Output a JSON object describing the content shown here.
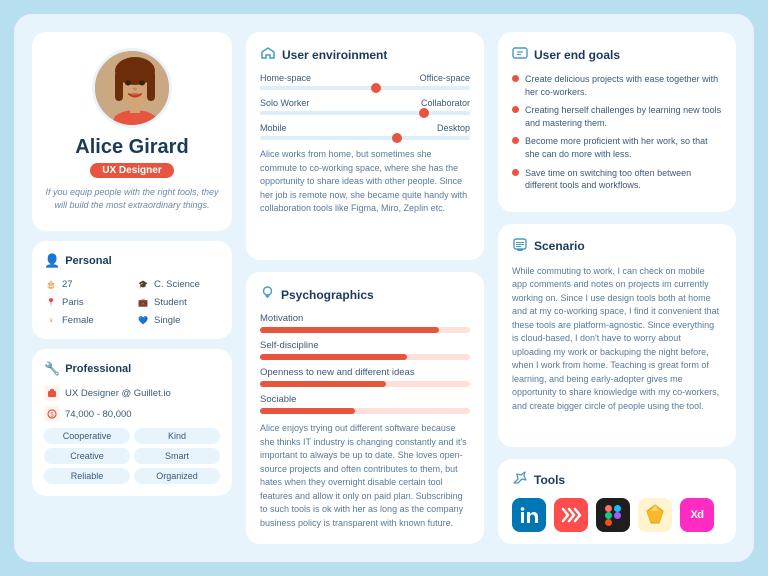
{
  "profile": {
    "name": "Alice Girard",
    "role": "UX Designer",
    "tagline": "If you equip people with the right tools, they will build the most extraordinary things."
  },
  "personal": {
    "section_title": "Personal",
    "age": "27",
    "field": "C. Science",
    "location": "Paris",
    "occupation": "Student",
    "gender": "Female",
    "status": "Single"
  },
  "professional": {
    "section_title": "Professional",
    "company": "UX Designer @ Guillet.io",
    "salary": "74,000 - 80,000",
    "tags": [
      "Cooperative",
      "Kind",
      "Creative",
      "Smart",
      "Reliable",
      "Organized"
    ]
  },
  "environment": {
    "title": "User enviroinment",
    "sliders": [
      {
        "left": "Home-space",
        "right": "Office-space",
        "position": 55
      },
      {
        "left": "Solo Worker",
        "right": "Collaborator",
        "position": 75
      },
      {
        "left": "Mobile",
        "right": "Desktop",
        "position": 65
      }
    ],
    "description": "Alice works from home, but sometimes she commute to co-working space, where she has the opportunity to share ideas with other people. Since her job is remote now, she became quite handy with collaboration tools like Figma, Miro, Zeplin etc."
  },
  "psychographics": {
    "title": "Psychographics",
    "bars": [
      {
        "label": "Motivation",
        "width": 85
      },
      {
        "label": "Self-discipline",
        "width": 70
      },
      {
        "label": "Openness to new and different ideas",
        "width": 60
      },
      {
        "label": "Sociable",
        "width": 45
      }
    ],
    "description": "Alice enjoys trying out different software because she thinks IT industry is changing constantly and it's important to always be up to date. She loves open-source projects and often contributes to them, but hates when they overnight disable certain tool features and allow it only on paid plan. Subscribing to such tools is ok with her as long as the company business policy is transparent with known future."
  },
  "goals": {
    "title": "User end goals",
    "items": [
      "Create delicious projects with ease together with her co-workers.",
      "Creating herself challenges by learning new tools and mastering them.",
      "Become more proficient with her work, so that she can do more with less.",
      "Save time on switching too often between different tools and workflows."
    ]
  },
  "scenario": {
    "title": "Scenario",
    "text": "While commuting to work, I can check on mobile app comments and notes on projects im currently working on. Since I use design tools both at home and at my co-working space, I find it convenient that these tools are platform-agnostic. Since everything is cloud-based, I don't have to worry about uploading my work or backuping the night before, when I work from home. Teaching is great form of learning, and being early-adopter gives me opportunity to share knowledge with my co-workers, and create bigger circle of people using the tool."
  },
  "tools": {
    "title": "Tools",
    "items": [
      "LinkedIn",
      "Miro",
      "Figma",
      "Sketch",
      "Adobe XD"
    ]
  }
}
